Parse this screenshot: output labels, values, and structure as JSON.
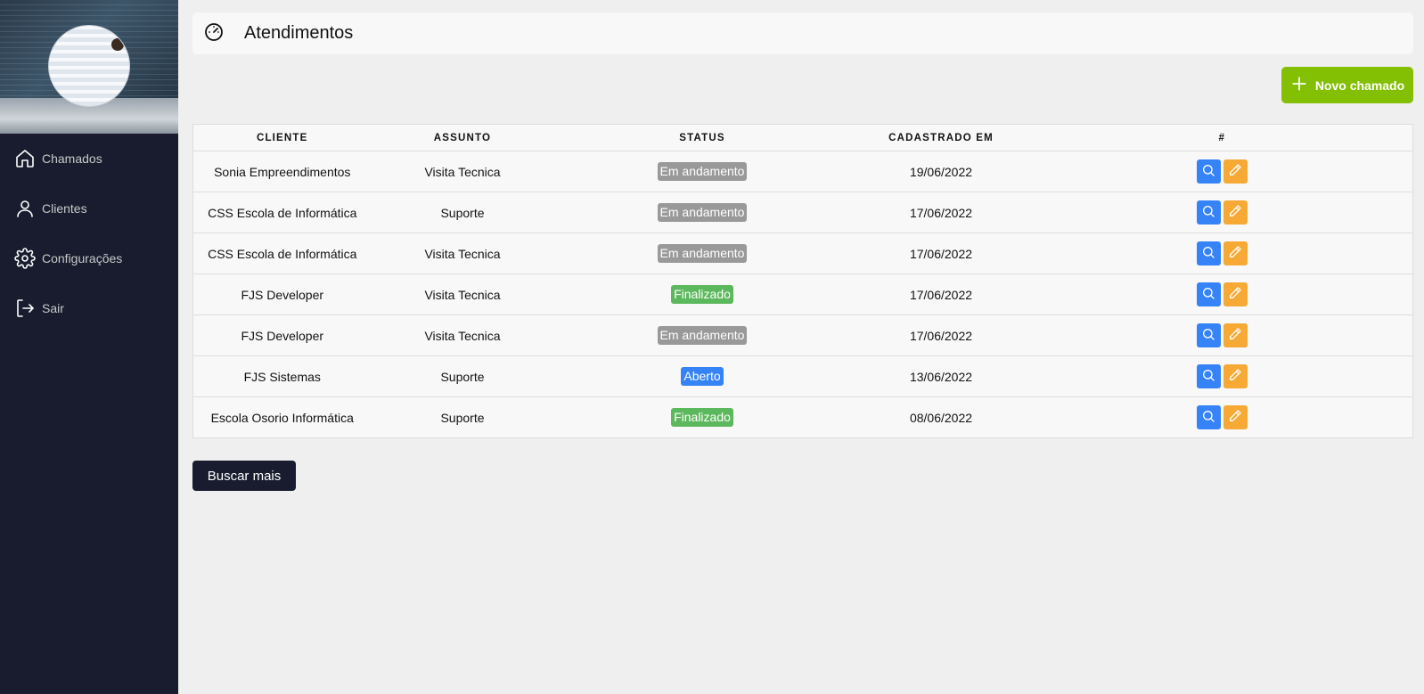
{
  "sidebar": {
    "items": [
      {
        "label": "Chamados",
        "icon": "home-icon"
      },
      {
        "label": "Clientes",
        "icon": "user-icon"
      },
      {
        "label": "Configurações",
        "icon": "gear-icon"
      },
      {
        "label": "Sair",
        "icon": "logout-icon"
      }
    ]
  },
  "header": {
    "title": "Atendimentos",
    "icon": "dashboard-gauge-icon"
  },
  "toolbar": {
    "new_label": "Novo chamado",
    "new_icon": "plus-icon"
  },
  "table": {
    "columns": [
      "Cliente",
      "Assunto",
      "Status",
      "Cadastrado em",
      "#"
    ],
    "rows": [
      {
        "cliente": "Sonia Empreendimentos",
        "assunto": "Visita Tecnica",
        "status": "Em andamento",
        "cadastrado": "19/06/2022"
      },
      {
        "cliente": "CSS Escola de Informática",
        "assunto": "Suporte",
        "status": "Em andamento",
        "cadastrado": "17/06/2022"
      },
      {
        "cliente": "CSS Escola de Informática",
        "assunto": "Visita Tecnica",
        "status": "Em andamento",
        "cadastrado": "17/06/2022"
      },
      {
        "cliente": "FJS Developer",
        "assunto": "Visita Tecnica",
        "status": "Finalizado",
        "cadastrado": "17/06/2022"
      },
      {
        "cliente": "FJS Developer",
        "assunto": "Visita Tecnica",
        "status": "Em andamento",
        "cadastrado": "17/06/2022"
      },
      {
        "cliente": "FJS Sistemas",
        "assunto": "Suporte",
        "status": "Aberto",
        "cadastrado": "13/06/2022"
      },
      {
        "cliente": "Escola Osorio Informática",
        "assunto": "Suporte",
        "status": "Finalizado",
        "cadastrado": "08/06/2022"
      }
    ]
  },
  "footer": {
    "more_label": "Buscar mais"
  },
  "colors": {
    "sidebar_bg": "#181c2e",
    "new_button": "#83bf02",
    "status_em_andamento": "#999999",
    "status_finalizado": "#5cb85c",
    "status_aberto": "#3583f6",
    "search_button": "#3583f6",
    "edit_button": "#f6a935"
  }
}
